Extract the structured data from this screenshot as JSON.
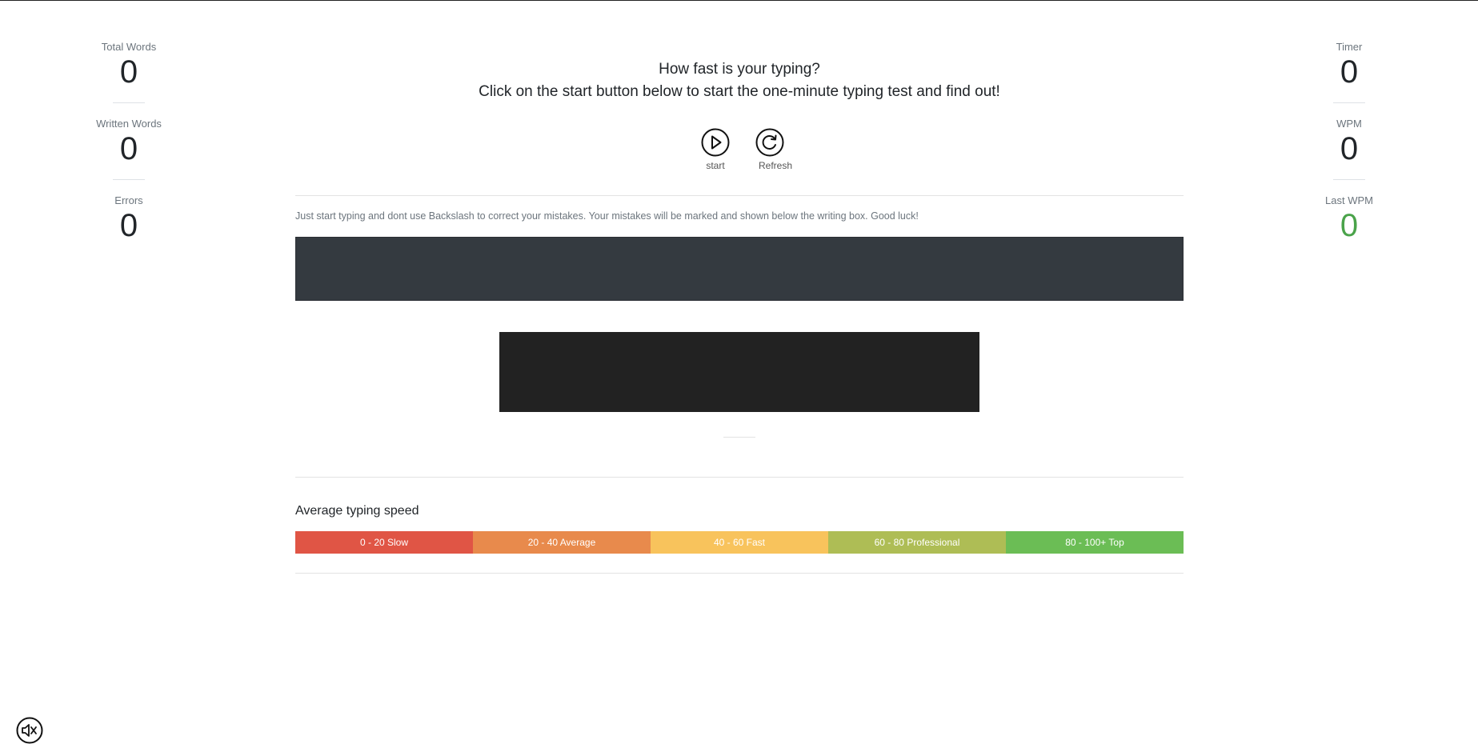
{
  "left_stats": [
    {
      "label": "Total Words",
      "value": "0"
    },
    {
      "label": "Written Words",
      "value": "0"
    },
    {
      "label": "Errors",
      "value": "0"
    }
  ],
  "right_stats": [
    {
      "label": "Timer",
      "value": "0"
    },
    {
      "label": "WPM",
      "value": "0"
    },
    {
      "label": "Last WPM",
      "value": "0"
    }
  ],
  "heading": {
    "line1": "How fast is your typing?",
    "line2": "Click on the start button below to start the one-minute typing test and find out!"
  },
  "controls": {
    "start_label": "start",
    "refresh_label": "Refresh",
    "start_icon": "play-circle-icon",
    "refresh_icon": "refresh-circle-icon"
  },
  "instructions": "Just start typing and dont use Backslash to correct your mistakes. Your mistakes will be marked and shown below the writing box. Good luck!",
  "typing_area": {
    "value": ""
  },
  "average_speed": {
    "title": "Average typing speed",
    "segments": [
      {
        "label": "0 - 20 Slow",
        "color": "#e05545"
      },
      {
        "label": "20 - 40 Average",
        "color": "#e88a4c"
      },
      {
        "label": "40 - 60 Fast",
        "color": "#f8c35c"
      },
      {
        "label": "60 - 80 Professional",
        "color": "#aebd55"
      },
      {
        "label": "80 - 100+ Top",
        "color": "#6bbd55"
      }
    ]
  },
  "colors": {
    "typing_box": "#343a40",
    "result_box": "#222222",
    "last_wpm": "#4aa34a"
  },
  "sound_icon": "sound-muted-icon"
}
